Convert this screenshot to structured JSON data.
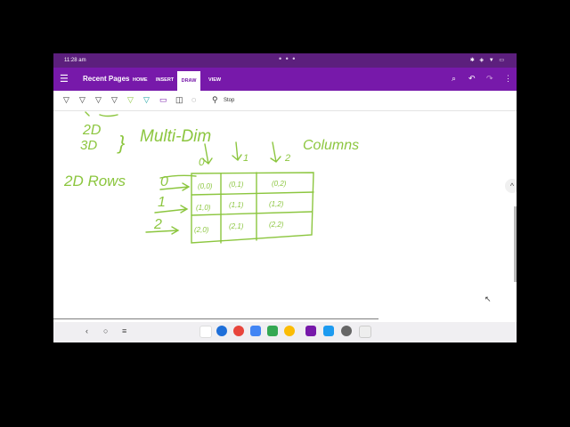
{
  "status_bar": {
    "time": "11:28 am",
    "dots": "• • •",
    "icons": "✱ ◈ ▼ ▭"
  },
  "app_bar": {
    "title": "Recent Pages",
    "tabs": [
      "HOME",
      "INSERT",
      "DRAW",
      "VIEW"
    ],
    "active_tab": "DRAW"
  },
  "toolbar": {
    "stop_label": "Stop"
  },
  "handwriting": {
    "line_2d": "2D",
    "line_3d": "3D",
    "brace": "}",
    "multi_dim": "Multi-Dim",
    "columns": "Columns",
    "rows": "2D  Rows",
    "row_indices": [
      "0",
      "1",
      "2"
    ],
    "col_indices": [
      "0",
      "1",
      "2"
    ],
    "cells": [
      [
        "(0,0)",
        "(0,1)",
        "(0,2)"
      ],
      [
        "(1,0)",
        "(1,1)",
        "(1,2)"
      ],
      [
        "(2,0)",
        "(2,1)",
        "(2,2)"
      ]
    ]
  },
  "colors": {
    "status_bar": "#5c1f7d",
    "app_bar": "#7719aa",
    "ink": "#8cc63f"
  },
  "nav_bar": {
    "back": "‹",
    "home": "○",
    "recents": "≡"
  }
}
